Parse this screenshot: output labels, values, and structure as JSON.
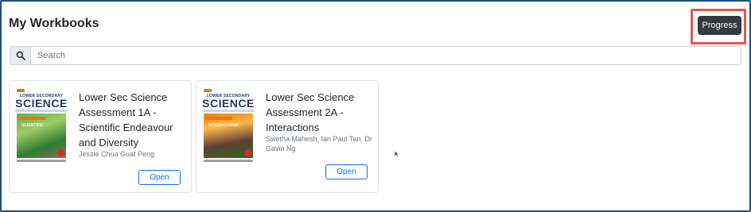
{
  "header": {
    "title": "My Workbooks",
    "progress_label": "Progress"
  },
  "search": {
    "icon": "search-icon",
    "placeholder": "Search",
    "value": ""
  },
  "workbooks": [
    {
      "cover_series": "LOWER SECONDARY",
      "cover_subject": "SCIENCE",
      "cover_theme": "SCIENTIFIC",
      "title": "Lower Sec Science Assessment 1A - Scientific Endeavour and Diversity",
      "authors": "Jessie Chua Guat Peng",
      "open_label": "Open"
    },
    {
      "cover_series": "LOWER SECONDARY",
      "cover_subject": "SCIENCE",
      "cover_theme": "INTERACTIONS",
      "title": "Lower Sec Science Assessment 2A - Interactions",
      "authors": "Swetha Mahesh, Ian Paul Tan, Dr Gavin Ng",
      "open_label": "Open"
    }
  ],
  "colors": {
    "frame_border": "#1f4e79",
    "progress_bg": "#343a40",
    "highlight": "#e0584b",
    "open_accent": "#0d6efd"
  }
}
